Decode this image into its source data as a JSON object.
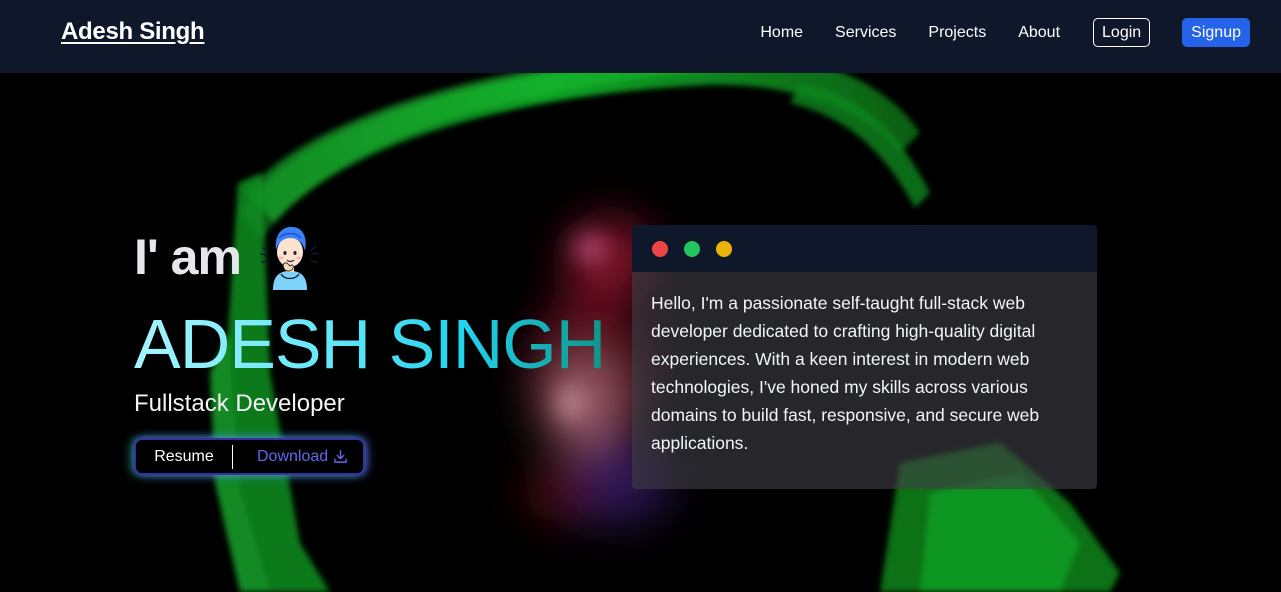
{
  "navbar": {
    "brand": "Adesh Singh",
    "links": [
      "Home",
      "Services",
      "Projects",
      "About"
    ],
    "login_label": "Login",
    "signup_label": "Signup",
    "signup_color": "#2563eb",
    "background": "#0f172a"
  },
  "hero": {
    "intro": "I' am",
    "avatar_icon": "developer-avatar-icon",
    "name": "ADESH SINGH",
    "role": "Fullstack Developer",
    "resume_label": "Resume",
    "download_label": "Download",
    "download_icon": "download-icon",
    "accent_color": "#6366f1"
  },
  "terminal": {
    "dots": [
      "#ef4444",
      "#22c55e",
      "#eab308"
    ],
    "bio": "Hello, I'm a passionate self-taught full-stack web developer dedicated to crafting high-quality digital experiences. With a keen interest in modern web technologies, I've honed my skills across various domains to build fast, responsive, and secure web applications."
  }
}
